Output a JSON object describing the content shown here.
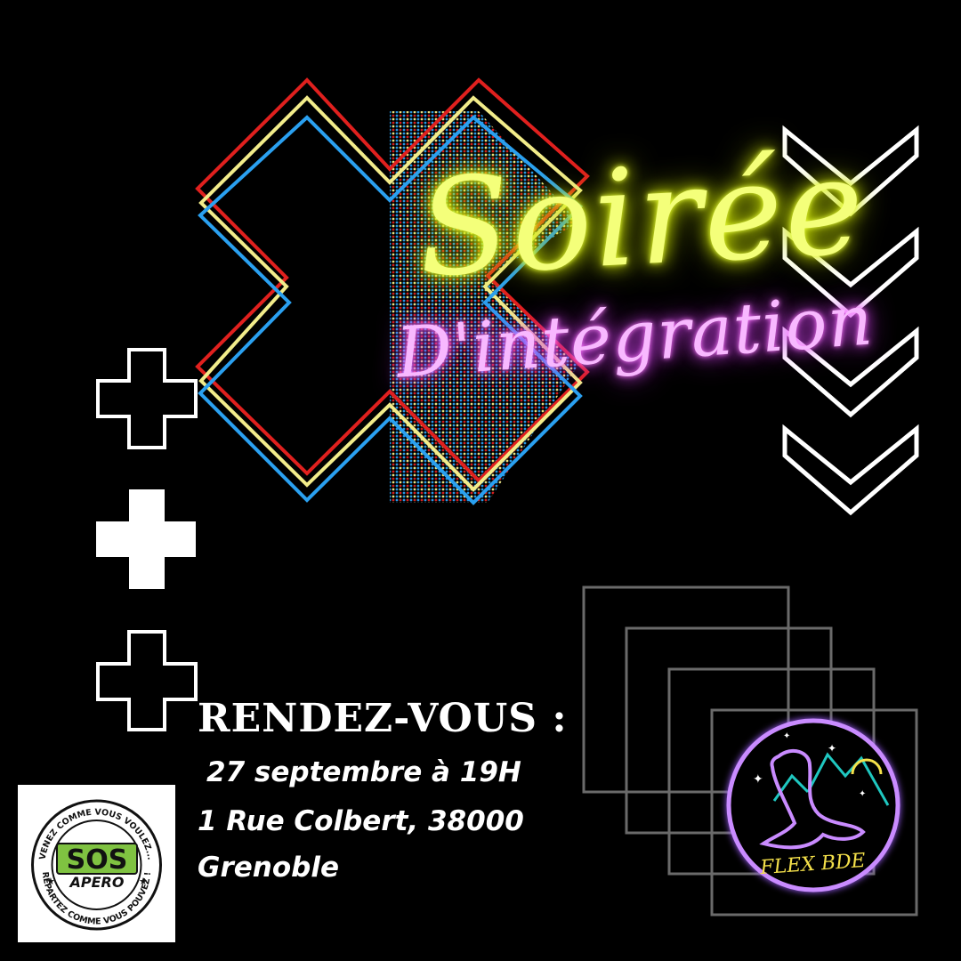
{
  "title": {
    "line1": "Soirée",
    "line2": "D'intégration"
  },
  "rendezvous": {
    "heading": "RENDEZ-VOUS :",
    "date": "27 septembre à 19H",
    "address_line1": "1 Rue Colbert, 38000",
    "address_line2": "Grenoble"
  },
  "sos_logo": {
    "ring_top": "VENEZ COMME VOUS VOULEZ...",
    "ring_bottom": "REPARTEZ COMME VOUS POUVEZ !",
    "main": "SOS",
    "sub": "APERO"
  },
  "bde_logo": {
    "text": "FLEX BDE"
  },
  "colors": {
    "background": "#000000",
    "neon_yellow": "#f4ff7a",
    "neon_pink": "#f8b8ff",
    "stripe_red": "#e0201e",
    "stripe_yellow": "#f2ec8a",
    "stripe_blue": "#2aa0f0",
    "sos_green": "#7fc241",
    "bde_purple": "#c98bff",
    "bde_teal": "#1fc7c0"
  },
  "icons": [
    "plus-outline-icon",
    "plus-solid-icon",
    "chevron-down-icon",
    "seal-icon",
    "star-icon"
  ]
}
